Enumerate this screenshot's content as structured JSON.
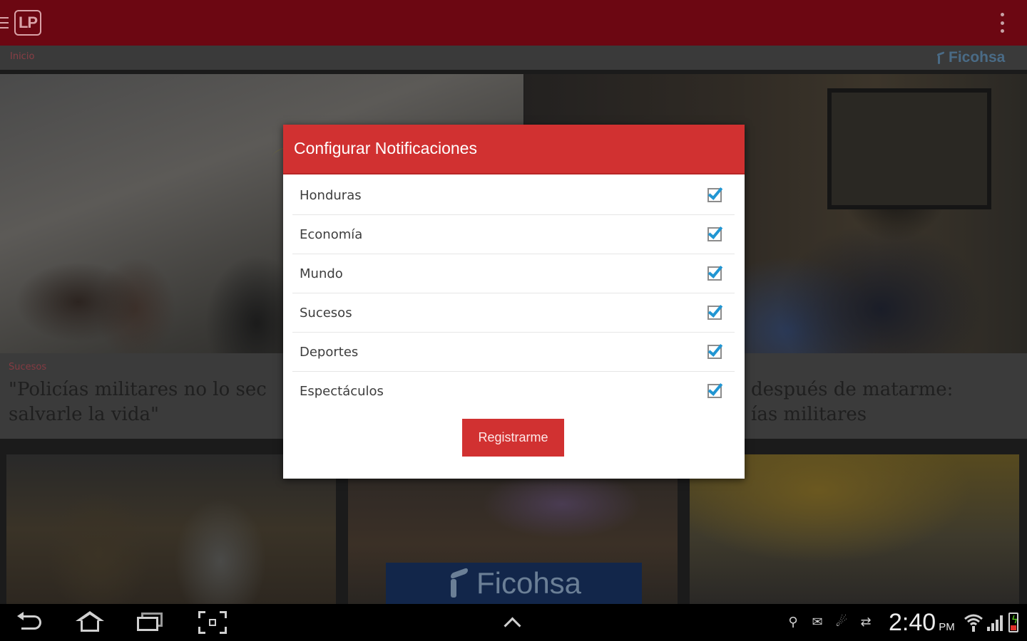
{
  "app": {
    "logo_text": "LP",
    "breadcrumb": "Inicio",
    "sponsor": "Ficohsa"
  },
  "feed": {
    "top_left": {
      "category": "Sucesos",
      "headline": "\"Policías militares no lo sec",
      "headline_line2": "salvarle la vida\""
    },
    "top_right": {
      "headline": "después de matarme:",
      "headline_line2": "ías militares"
    },
    "banner_text": "Ficohsa"
  },
  "dialog": {
    "title": "Configurar Notificaciones",
    "options": [
      {
        "label": "Honduras",
        "checked": true
      },
      {
        "label": "Economía",
        "checked": true
      },
      {
        "label": "Mundo",
        "checked": true
      },
      {
        "label": "Sucesos",
        "checked": true
      },
      {
        "label": "Deportes",
        "checked": true
      },
      {
        "label": "Espectáculos",
        "checked": true
      }
    ],
    "register_label": "Registrarme"
  },
  "system_bar": {
    "time": "2:40",
    "ampm": "PM",
    "status_icons": [
      "usb-icon",
      "email-icon",
      "wifi-alert-icon",
      "sync-icon"
    ]
  },
  "colors": {
    "actionbar": "#6c0712",
    "dialog_header": "#d13131",
    "register_button": "#d13131",
    "checkbox_check": "#2196d3"
  }
}
